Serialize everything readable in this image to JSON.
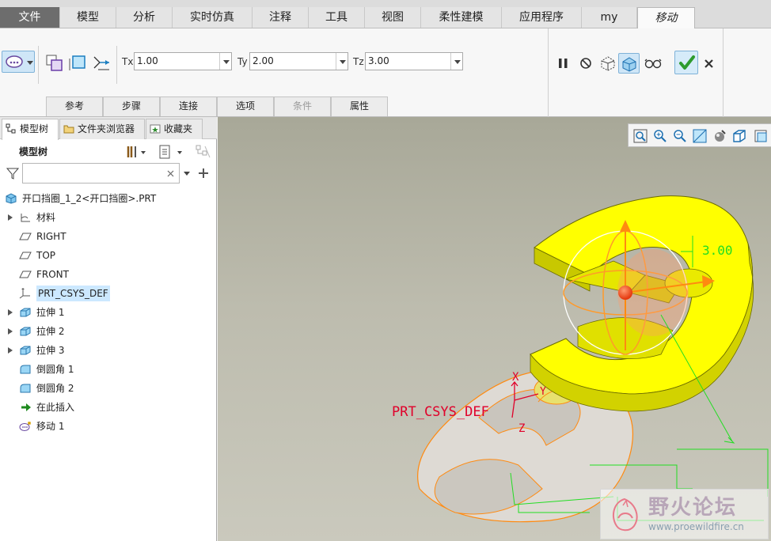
{
  "ribbon_tabs": [
    "文件",
    "模型",
    "分析",
    "实时仿真",
    "注释",
    "工具",
    "视图",
    "柔性建模",
    "应用程序",
    "my",
    "移动"
  ],
  "active_tab": "移动",
  "transform": {
    "tx_label": "Tx",
    "tx_value": "1.00",
    "ty_label": "Ty",
    "ty_value": "2.00",
    "tz_label": "Tz",
    "tz_value": "3.00"
  },
  "sub_tabs": [
    "参考",
    "步骤",
    "连接",
    "选项",
    "条件",
    "属性"
  ],
  "panel_tabs": [
    "模型树",
    "文件夹浏览器",
    "收藏夹"
  ],
  "model_tree_label": "模型树",
  "filter_placeholder": "",
  "tree": [
    {
      "label": "开口挡圈_1_2<开口挡圈>.PRT",
      "icon": "part-icon",
      "expandable": false,
      "indent": 0
    },
    {
      "label": "材料",
      "icon": "material-icon",
      "expandable": true,
      "indent": 1
    },
    {
      "label": "RIGHT",
      "icon": "datum-plane-icon",
      "expandable": false,
      "indent": 1
    },
    {
      "label": "TOP",
      "icon": "datum-plane-icon",
      "expandable": false,
      "indent": 1
    },
    {
      "label": "FRONT",
      "icon": "datum-plane-icon",
      "expandable": false,
      "indent": 1
    },
    {
      "label": "PRT_CSYS_DEF",
      "icon": "csys-icon",
      "expandable": false,
      "indent": 1,
      "selected": true
    },
    {
      "label": "拉伸 1",
      "icon": "extrude-icon",
      "expandable": true,
      "indent": 1
    },
    {
      "label": "拉伸 2",
      "icon": "extrude-icon",
      "expandable": true,
      "indent": 1
    },
    {
      "label": "拉伸 3",
      "icon": "extrude-icon",
      "expandable": true,
      "indent": 1
    },
    {
      "label": "倒圆角 1",
      "icon": "round-icon",
      "expandable": false,
      "indent": 1
    },
    {
      "label": "倒圆角 2",
      "icon": "round-icon",
      "expandable": false,
      "indent": 1
    },
    {
      "label": "在此插入",
      "icon": "insert-here-icon",
      "expandable": false,
      "indent": 1
    },
    {
      "label": "移动 1",
      "icon": "move-icon",
      "expandable": false,
      "indent": 1
    }
  ],
  "viewport": {
    "dimension_label": "3.00",
    "csys_label": "PRT_CSYS_DEF",
    "axis_x": "X",
    "axis_y": "Y",
    "axis_z": "Z",
    "watermark_title": "野火论坛",
    "watermark_url": "www.proewildfire.cn"
  },
  "colors": {
    "accent_yellow": "#ffff00",
    "outline_orange": "#ff8800",
    "dim_green": "#22dd22",
    "csys_red": "#e0002a",
    "confirm_green": "#2e9b2e"
  }
}
